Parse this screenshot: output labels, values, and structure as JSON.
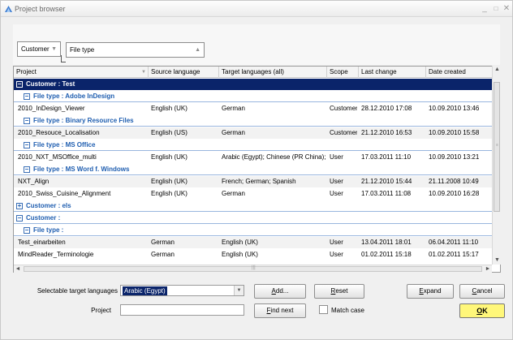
{
  "window": {
    "title": "Project browser",
    "minimize": "_",
    "maximize": "□",
    "close": "✕"
  },
  "group_panel": {
    "chips": [
      {
        "label": "Customer",
        "icon": "dropdown-arrow-icon"
      },
      {
        "label": "File type",
        "icon": "sort-up-icon"
      }
    ]
  },
  "grid": {
    "columns": [
      {
        "label": "Project"
      },
      {
        "label": "Source language"
      },
      {
        "label": "Target languages (all)"
      },
      {
        "label": "Scope"
      },
      {
        "label": "Last change"
      },
      {
        "label": "Date created"
      }
    ],
    "rows": [
      {
        "kind": "group",
        "level": 0,
        "label": "Customer : Test",
        "selected": true,
        "expander": "−"
      },
      {
        "kind": "group",
        "level": 1,
        "label": "File type : Adobe InDesign",
        "expander": "−"
      },
      {
        "kind": "data",
        "cells": [
          "2010_InDesign_Viewer",
          "English (UK)",
          "German",
          "Customer",
          "28.12.2010 17:08",
          "10.09.2010 13:46"
        ]
      },
      {
        "kind": "group",
        "level": 1,
        "label": "File type : Binary Resource Files",
        "expander": "−"
      },
      {
        "kind": "data",
        "cells": [
          "2010_Resouce_Localisation",
          "English (US)",
          "German",
          "Customer",
          "21.12.2010 16:53",
          "10.09.2010 15:58"
        ]
      },
      {
        "kind": "group",
        "level": 1,
        "label": "File type : MS Office",
        "expander": "−"
      },
      {
        "kind": "data",
        "cells": [
          "2010_NXT_MSOffice_multi",
          "English (UK)",
          "Arabic (Egypt); Chinese (PR China); Ch",
          "User",
          "17.03.2011 11:10",
          "10.09.2010 13:21"
        ]
      },
      {
        "kind": "group",
        "level": 1,
        "label": "File type : MS Word f. Windows",
        "expander": "−"
      },
      {
        "kind": "data",
        "cells": [
          "NXT_Align",
          "English (UK)",
          "French; German; Spanish",
          "User",
          "21.12.2010 15:44",
          "21.11.2008 10:49"
        ]
      },
      {
        "kind": "data",
        "cells": [
          "2010_Swiss_Cuisine_Alignment",
          "English (UK)",
          "German",
          "User",
          "17.03.2011 11:08",
          "10.09.2010 16:28"
        ]
      },
      {
        "kind": "group",
        "level": 0,
        "label": "Customer : els",
        "expander": "+"
      },
      {
        "kind": "group",
        "level": 0,
        "label": "Customer :",
        "expander": "−"
      },
      {
        "kind": "group",
        "level": 1,
        "label": "File type :",
        "expander": "−"
      },
      {
        "kind": "data",
        "cells": [
          "Test_einarbeiten",
          "German",
          "English (UK)",
          "User",
          "13.04.2011 18:01",
          "06.04.2011 11:10"
        ]
      },
      {
        "kind": "data",
        "cells": [
          "MindReader_Terminologie",
          "German",
          "English (UK)",
          "User",
          "01.02.2011 15:18",
          "01.02.2011 15:17"
        ]
      }
    ]
  },
  "scrollbars": {
    "up": "▲",
    "down": "▼",
    "left": "◄",
    "right": "►",
    "grip_v": "≡",
    "grip_h": "|||"
  },
  "footer": {
    "target_label": "Selectable target languages",
    "target_value": "Arabic (Egypt)",
    "dropdown_arrow": "▼",
    "project_label": "Project",
    "project_value": "",
    "add": "Add...",
    "reset": "Reset",
    "expand": "Expand",
    "cancel": "Cancel",
    "find_next": "Find next",
    "match_case": "Match case",
    "ok": "OK",
    "match_case_checked": false
  }
}
